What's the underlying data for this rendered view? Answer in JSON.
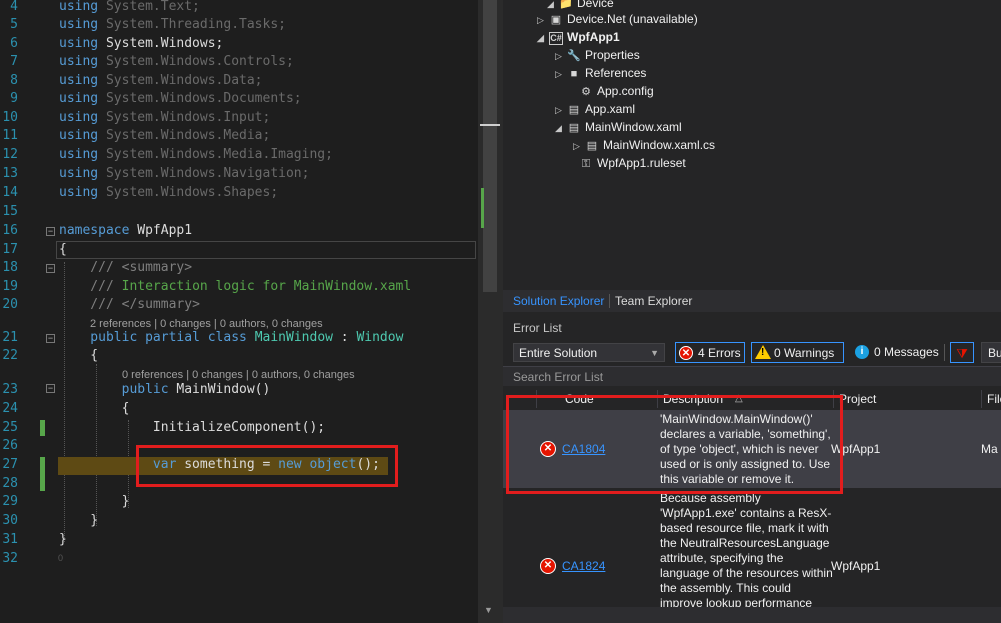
{
  "editor": {
    "lines": [
      {
        "num": "4",
        "tokens": [
          {
            "t": "using",
            "c": "kw"
          },
          {
            "t": " System.Text;",
            "c": "dim"
          }
        ]
      },
      {
        "num": "5",
        "tokens": [
          {
            "t": "using",
            "c": "kw"
          },
          {
            "t": " System.Threading.Tasks;",
            "c": "dim"
          }
        ]
      },
      {
        "num": "6",
        "tokens": [
          {
            "t": "using",
            "c": "kw"
          },
          {
            "t": " System.Windows;",
            "c": ""
          }
        ]
      },
      {
        "num": "7",
        "tokens": [
          {
            "t": "using",
            "c": "kw"
          },
          {
            "t": " System.Windows.Controls;",
            "c": "dim"
          }
        ]
      },
      {
        "num": "8",
        "tokens": [
          {
            "t": "using",
            "c": "kw"
          },
          {
            "t": " System.Windows.Data;",
            "c": "dim"
          }
        ]
      },
      {
        "num": "9",
        "tokens": [
          {
            "t": "using",
            "c": "kw"
          },
          {
            "t": " System.Windows.Documents;",
            "c": "dim"
          }
        ]
      },
      {
        "num": "10",
        "tokens": [
          {
            "t": "using",
            "c": "kw"
          },
          {
            "t": " System.Windows.Input;",
            "c": "dim"
          }
        ]
      },
      {
        "num": "11",
        "tokens": [
          {
            "t": "using",
            "c": "kw"
          },
          {
            "t": " System.Windows.Media;",
            "c": "dim"
          }
        ]
      },
      {
        "num": "12",
        "tokens": [
          {
            "t": "using",
            "c": "kw"
          },
          {
            "t": " System.Windows.Media.Imaging;",
            "c": "dim"
          }
        ]
      },
      {
        "num": "13",
        "tokens": [
          {
            "t": "using",
            "c": "kw"
          },
          {
            "t": " System.Windows.Navigation;",
            "c": "dim"
          }
        ]
      },
      {
        "num": "14",
        "tokens": [
          {
            "t": "using",
            "c": "kw"
          },
          {
            "t": " System.Windows.Shapes;",
            "c": "dim"
          }
        ]
      },
      {
        "num": "15",
        "tokens": []
      },
      {
        "num": "16",
        "tokens": [
          {
            "t": "namespace",
            "c": "kw"
          },
          {
            "t": " WpfApp1",
            "c": ""
          }
        ]
      },
      {
        "num": "17",
        "tokens": [
          {
            "t": "{",
            "c": ""
          }
        ]
      },
      {
        "num": "18",
        "tokens": [
          {
            "t": "    /// ",
            "c": "ns"
          },
          {
            "t": "<summary>",
            "c": "ns"
          }
        ]
      },
      {
        "num": "19",
        "tokens": [
          {
            "t": "    /// ",
            "c": "ns"
          },
          {
            "t": "Interaction logic for MainWindow.xaml",
            "c": "cm"
          }
        ]
      },
      {
        "num": "20",
        "tokens": [
          {
            "t": "    /// ",
            "c": "ns"
          },
          {
            "t": "</summary>",
            "c": "ns"
          }
        ]
      },
      {
        "num": "21",
        "tokens": [
          {
            "t": "    public",
            "c": "kw"
          },
          {
            "t": " partial",
            "c": "kw"
          },
          {
            "t": " class",
            "c": "kw"
          },
          {
            "t": " MainWindow",
            "c": "ty"
          },
          {
            "t": " : ",
            "c": ""
          },
          {
            "t": "Window",
            "c": "ty"
          }
        ]
      },
      {
        "num": "22",
        "tokens": [
          {
            "t": "    {",
            "c": ""
          }
        ]
      },
      {
        "num": "23",
        "tokens": [
          {
            "t": "        public",
            "c": "kw"
          },
          {
            "t": " MainWindow()",
            "c": ""
          }
        ]
      },
      {
        "num": "24",
        "tokens": [
          {
            "t": "        {",
            "c": ""
          }
        ]
      },
      {
        "num": "25",
        "tokens": [
          {
            "t": "            InitializeComponent();",
            "c": ""
          }
        ]
      },
      {
        "num": "26",
        "tokens": []
      },
      {
        "num": "27",
        "tokens": [
          {
            "t": "            var",
            "c": "kw"
          },
          {
            "t": " something = ",
            "c": ""
          },
          {
            "t": "new",
            "c": "kw"
          },
          {
            "t": " object",
            "c": "kw"
          },
          {
            "t": "();",
            "c": ""
          }
        ]
      },
      {
        "num": "28",
        "tokens": []
      },
      {
        "num": "29",
        "tokens": [
          {
            "t": "        }",
            "c": ""
          }
        ]
      },
      {
        "num": "30",
        "tokens": [
          {
            "t": "    }",
            "c": ""
          }
        ]
      },
      {
        "num": "31",
        "tokens": [
          {
            "t": "}",
            "c": ""
          }
        ]
      },
      {
        "num": "32",
        "tokens": []
      }
    ],
    "codelens_class": "2 references | 0 changes | 0 authors, 0 changes",
    "codelens_ctor": "0 references | 0 changes | 0 authors, 0 changes",
    "trailing_zero": "0"
  },
  "solution_explorer": {
    "nodes": [
      {
        "label": "Device",
        "arrow": "◢",
        "icon": "📁",
        "name": "device"
      },
      {
        "label": "Device.Net (unavailable)",
        "arrow": "▷",
        "icon": "▣",
        "name": "device-net"
      },
      {
        "label": "WpfApp1",
        "arrow": "◢",
        "icon": "C#",
        "name": "wpfapp1"
      },
      {
        "label": "Properties",
        "arrow": "▷",
        "icon": "🔧",
        "name": "properties"
      },
      {
        "label": "References",
        "arrow": "▷",
        "icon": "■",
        "name": "references"
      },
      {
        "label": "App.config",
        "arrow": "",
        "icon": "⚙",
        "name": "app-config"
      },
      {
        "label": "App.xaml",
        "arrow": "▷",
        "icon": "▤",
        "name": "app-xaml"
      },
      {
        "label": "MainWindow.xaml",
        "arrow": "◢",
        "icon": "▤",
        "name": "mainwindow-xaml"
      },
      {
        "label": "MainWindow.xaml.cs",
        "arrow": "▷",
        "icon": "▤",
        "name": "mainwindow-xaml-cs"
      },
      {
        "label": "WpfApp1.ruleset",
        "arrow": "",
        "icon": "⚿",
        "name": "ruleset"
      }
    ],
    "tabs": {
      "solution": "Solution Explorer",
      "team": "Team Explorer"
    }
  },
  "error_list": {
    "title": "Error List",
    "scope": "Entire Solution",
    "errors_btn": "4 Errors",
    "warnings_btn": "0 Warnings",
    "messages_btn": "0 Messages",
    "build_btn": "Bu",
    "search_placeholder": "Search Error List",
    "columns": {
      "code": "Code",
      "description": "Description",
      "project": "Project",
      "file": "File"
    },
    "rows": [
      {
        "code": "CA1804",
        "description": "'MainWindow.MainWindow()' declares a variable, 'something', of type 'object', which is never used or is only assigned to. Use this variable or remove it.",
        "project": "WpfApp1",
        "file": "Ma"
      },
      {
        "code": "CA1824",
        "description": "Because assembly 'WpfApp1.exe' contains a ResX-based resource file, mark it with the NeutralResourcesLanguage attribute, specifying the language of the resources within the assembly. This could improve lookup performance",
        "project": "WpfApp1",
        "file": ""
      }
    ]
  },
  "colors": {
    "highlight_box": "#e21d1d",
    "error_red": "#e51400",
    "link_blue": "#3794ff",
    "warning_yellow": "#ffcc00",
    "info_blue": "#1ba1e2"
  }
}
